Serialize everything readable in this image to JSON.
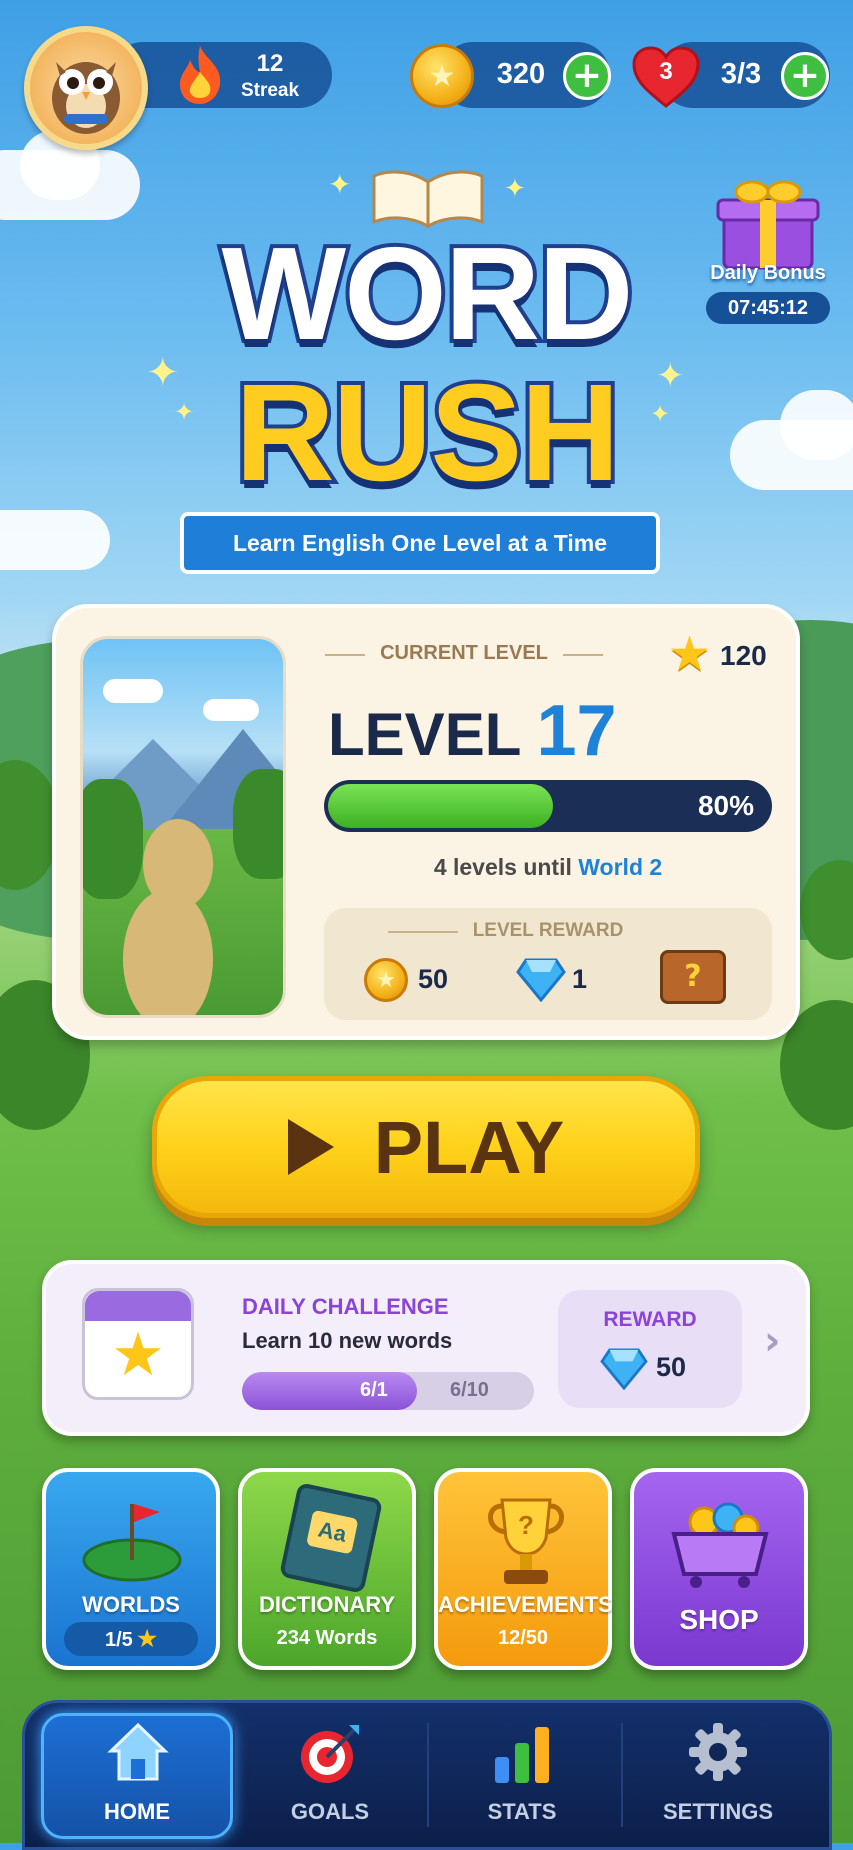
{
  "player": {
    "streak_count": "12",
    "streak_label": "Streak",
    "coins": "320",
    "lives_badge": "3",
    "lives": "3/3"
  },
  "daily_bonus": {
    "label": "Daily Bonus",
    "timer": "07:45:12"
  },
  "title": {
    "line1": "WORD",
    "line2": "RUSH",
    "tagline": "Learn English One Level at a Time"
  },
  "level_card": {
    "header": "CURRENT LEVEL",
    "stars": "120",
    "level_word": "LEVEL",
    "level_number": "17",
    "progress_percent": 80,
    "progress_label": "80%",
    "until_text": "4 levels until",
    "until_world": "World 2",
    "reward_header": "LEVEL REWARD",
    "reward_coins": "50",
    "reward_gems": "1"
  },
  "play_button": {
    "label": "PLAY"
  },
  "daily_challenge": {
    "title": "DAILY CHALLENGE",
    "description": "Learn 10 new words",
    "progress_fraction": 0.6,
    "progress_fill_text": "6/1",
    "progress_text": "6/10",
    "reward_label": "REWARD",
    "reward_value": "50"
  },
  "tiles": {
    "worlds": {
      "label": "WORLDS",
      "sub": "1/5"
    },
    "dictionary": {
      "label": "DICTIONARY",
      "sub": "234 Words"
    },
    "achievements": {
      "label": "ACHIEVEMENTS",
      "sub": "12/50"
    },
    "shop": {
      "label": "SHOP"
    }
  },
  "nav": {
    "home": "HOME",
    "goals": "GOALS",
    "stats": "STATS",
    "settings": "SETTINGS"
  },
  "colors": {
    "accent_blue": "#1e7ed8",
    "play_yellow": "#ffd21a",
    "progress_green": "#3db023",
    "challenge_purple": "#8a52d8"
  }
}
